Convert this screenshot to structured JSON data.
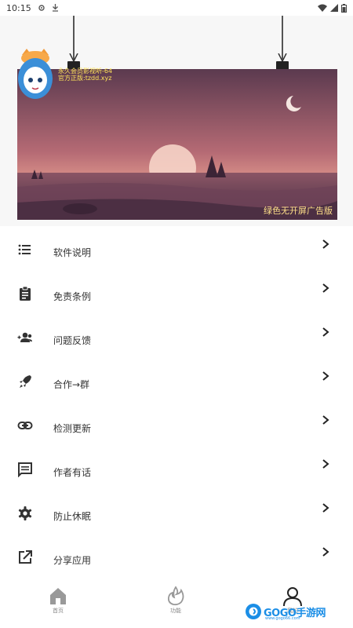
{
  "status_bar": {
    "time": "10:15"
  },
  "banner": {
    "ad_label": "绿色无开屏广告版",
    "mascot_caption_line1": "永久会员影视听-64",
    "mascot_caption_line2": "官方正版:tzdd.xyz"
  },
  "menu": {
    "items": [
      {
        "label": "软件说明",
        "icon": "list-icon"
      },
      {
        "label": "免责条例",
        "icon": "clipboard-icon"
      },
      {
        "label": "问题反馈",
        "icon": "people-add-icon"
      },
      {
        "label": "合作→群",
        "icon": "rocket-icon"
      },
      {
        "label": "检测更新",
        "icon": "link-icon"
      },
      {
        "label": "作者有话",
        "icon": "message-icon"
      },
      {
        "label": "防止休眠",
        "icon": "gear-icon"
      },
      {
        "label": "分享应用",
        "icon": "share-external-icon"
      }
    ]
  },
  "bottom_nav": {
    "items": [
      {
        "label": "首页",
        "icon": "home-icon"
      },
      {
        "label": "功能",
        "icon": "flame-icon"
      },
      {
        "label": "我的",
        "icon": "person-icon"
      }
    ]
  },
  "watermark": {
    "text": "GOGO手游网",
    "url": "www.gogo66.com"
  }
}
